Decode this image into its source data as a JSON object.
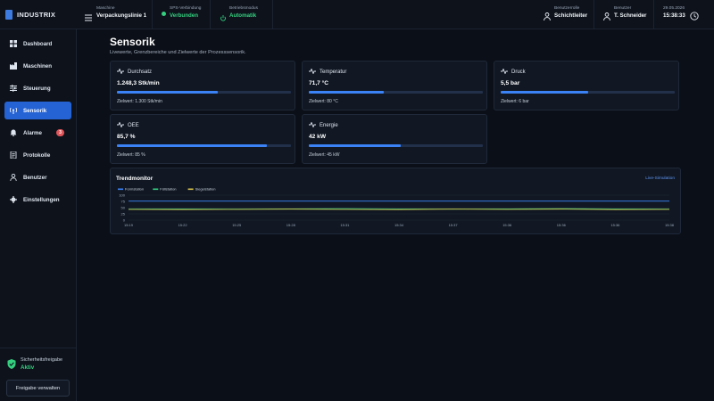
{
  "sidebar": {
    "brand": "INDUSTRIX",
    "items": [
      {
        "label": "Dashboard",
        "icon": "grid-icon"
      },
      {
        "label": "Maschinen",
        "icon": "factory-icon"
      },
      {
        "label": "Steuerung",
        "icon": "sliders-icon"
      },
      {
        "label": "Sensorik",
        "icon": "antenna-icon"
      },
      {
        "label": "Alarme",
        "icon": "bell-icon",
        "badge": "3"
      },
      {
        "label": "Protokolle",
        "icon": "log-icon"
      },
      {
        "label": "Benutzer",
        "icon": "users-icon"
      },
      {
        "label": "Einstellungen",
        "icon": "gear-icon"
      }
    ],
    "safety_label": "Sicherheitsfreigabe",
    "safety_value": "Aktiv",
    "manage_button": "Freigabe verwalten"
  },
  "header": {
    "machine_label": "Maschine",
    "machine_value": "Verpackungslinie 1",
    "plc_label": "SPS-Verbindung",
    "plc_value": "Verbunden",
    "mode_label": "Betriebsmodus",
    "mode_value": "Automatik",
    "role_label": "Benutzerrolle",
    "role_value": "Schichtleiter",
    "user_label": "Benutzer",
    "user_value": "T. Schneider",
    "date": "29.05.2026",
    "time": "15:38:33"
  },
  "page": {
    "title": "Sensorik",
    "subtitle": "Livewerte, Grenzbereiche und Zielwerte der Prozesssensorik."
  },
  "cards": [
    {
      "name": "Durchsatz",
      "value": "1.248,3 Stk/min",
      "target": "Zielwert: 1.300 Stk/min",
      "level": 0.58
    },
    {
      "name": "Temperatur",
      "value": "71,7 °C",
      "target": "Zielwert: 80 °C",
      "level": 0.43
    },
    {
      "name": "Druck",
      "value": "5,5 bar",
      "target": "Zielwert: 6 bar",
      "level": 0.5
    },
    {
      "name": "OEE",
      "value": "85,7 %",
      "target": "Zielwert: 85 %",
      "level": 0.86
    },
    {
      "name": "Energie",
      "value": "42 kW",
      "target": "Zielwert: 45 kW",
      "level": 0.53
    }
  ],
  "trend": {
    "title": "Trendmonitor",
    "live_label": "Live-Simulation"
  },
  "chart_data": {
    "type": "line",
    "x": [
      "15:19",
      "15:22",
      "15:25",
      "15:28",
      "15:31",
      "15:34",
      "15:37",
      "15:36",
      "15:36",
      "15:36",
      "15:38"
    ],
    "ylim": [
      0,
      100
    ],
    "yticks": [
      0,
      25,
      50,
      75,
      100
    ],
    "legend": "top-left",
    "series": [
      {
        "name": "Formstation",
        "color": "#3b82f6",
        "values": [
          76,
          76,
          76,
          76,
          76,
          76,
          76,
          76,
          76,
          76,
          76
        ]
      },
      {
        "name": "Füllstation",
        "color": "#35d07f",
        "values": [
          44,
          45,
          44,
          45,
          46,
          45,
          44,
          45,
          46,
          45,
          44
        ]
      },
      {
        "name": "Siegelstation",
        "color": "#d9c34a",
        "values": [
          43,
          42,
          43,
          44,
          43,
          42,
          44,
          43,
          44,
          42,
          43
        ]
      }
    ]
  }
}
